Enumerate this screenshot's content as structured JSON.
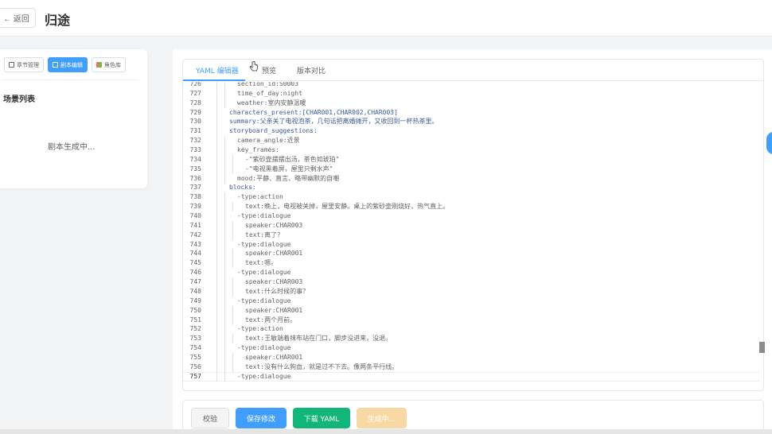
{
  "header": {
    "back_label": "← 返回",
    "title": "归途"
  },
  "left_panel": {
    "tabs": [
      {
        "label": "章节管理",
        "icon": "document-icon",
        "active": false
      },
      {
        "label": "剧本编辑",
        "icon": "edit-icon",
        "active": true
      },
      {
        "label": "角色库",
        "icon": "palette-icon",
        "active": false
      }
    ],
    "scene_list_title": "场景列表",
    "status_text": "剧本生成中..."
  },
  "editor": {
    "tabs": [
      {
        "label": "YAML 编辑器",
        "active": true
      },
      {
        "label": "预览",
        "active": false
      },
      {
        "label": "版本对比",
        "active": false
      }
    ],
    "code_lines": [
      {
        "num": "726",
        "text": "section_id:S0003",
        "indent": 2
      },
      {
        "num": "727",
        "text": "time_of_day:night",
        "indent": 2
      },
      {
        "num": "728",
        "text": "weather:室内安静温暖",
        "indent": 2
      },
      {
        "num": "729",
        "text": "characters_present:[CHAR001,CHAR002,CHAR003]",
        "indent": 1
      },
      {
        "num": "730",
        "text": "summary:父亲关了电视泡茶，几句话把离婚摊开，又收回到一杯热茶里。",
        "indent": 1
      },
      {
        "num": "731",
        "text": "storyboard_suggestions:",
        "indent": 1
      },
      {
        "num": "732",
        "text": "camera_angle:近景",
        "indent": 2
      },
      {
        "num": "733",
        "text": "key_frames:",
        "indent": 2
      },
      {
        "num": "734",
        "text": "-\"紫砂壶摆摆出汤，茶色如琥珀\"",
        "indent": 3
      },
      {
        "num": "735",
        "text": "-\"电视黑着屏，屋里只剩水声\"",
        "indent": 3
      },
      {
        "num": "736",
        "text": "mood:平静、直言、略带幽默的自嘲",
        "indent": 2
      },
      {
        "num": "737",
        "text": "blocks:",
        "indent": 1
      },
      {
        "num": "738",
        "text": "-type:action",
        "indent": 2
      },
      {
        "num": "739",
        "text": "text:晚上，电视被关掉，屋里安静。桌上的紫砂壶刚烧好，热气直上。",
        "indent": 3
      },
      {
        "num": "740",
        "text": "-type:dialogue",
        "indent": 2
      },
      {
        "num": "741",
        "text": "speaker:CHAR003",
        "indent": 3
      },
      {
        "num": "742",
        "text": "text:离了？",
        "indent": 3
      },
      {
        "num": "743",
        "text": "-type:dialogue",
        "indent": 2
      },
      {
        "num": "744",
        "text": "speaker:CHAR001",
        "indent": 3
      },
      {
        "num": "745",
        "text": "text:嗯。",
        "indent": 3
      },
      {
        "num": "746",
        "text": "-type:dialogue",
        "indent": 2
      },
      {
        "num": "747",
        "text": "speaker:CHAR003",
        "indent": 3
      },
      {
        "num": "748",
        "text": "text:什么时候的事？",
        "indent": 3
      },
      {
        "num": "749",
        "text": "-type:dialogue",
        "indent": 2
      },
      {
        "num": "750",
        "text": "speaker:CHAR001",
        "indent": 3
      },
      {
        "num": "751",
        "text": "text:两个月前。",
        "indent": 3
      },
      {
        "num": "752",
        "text": "-type:action",
        "indent": 2
      },
      {
        "num": "753",
        "text": "text:王敏端着抹布站在门口，脚步没进来，没退。",
        "indent": 3
      },
      {
        "num": "754",
        "text": "-type:dialogue",
        "indent": 2
      },
      {
        "num": "755",
        "text": "speaker:CHAR001",
        "indent": 3
      },
      {
        "num": "756",
        "text": "text:没有什么狗血，就是过不下去。像两条平行线。",
        "indent": 3
      },
      {
        "num": "757",
        "text": "-type:dialogue",
        "indent": 2,
        "current": true
      }
    ]
  },
  "actions": {
    "validate_label": "校验",
    "save_label": "保存修改",
    "download_label": "下载 YAML",
    "generating_label": "生成中..."
  },
  "colors": {
    "primary": "#409eff",
    "success": "#13b67a",
    "warning_disabled": "#f8d9a4"
  }
}
